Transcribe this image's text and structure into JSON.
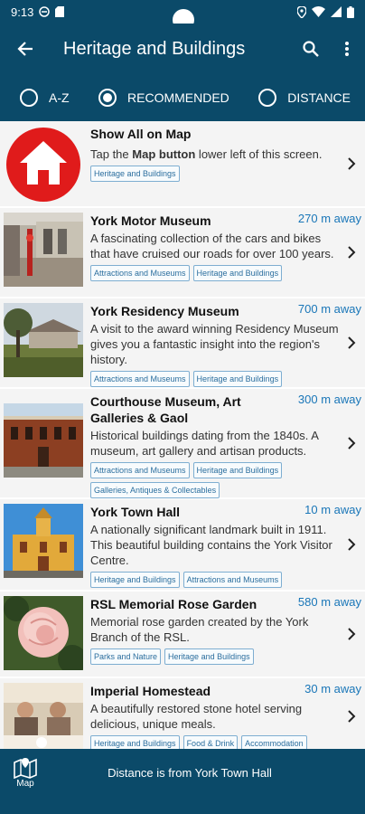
{
  "status": {
    "time": "9:13"
  },
  "appbar": {
    "title": "Heritage and Buildings"
  },
  "filters": {
    "az": "A-Z",
    "recommended": "RECOMMENDED",
    "distance": "DISTANCE"
  },
  "show_all": {
    "title": "Show All on Map",
    "desc_pre": "Tap the ",
    "desc_bold": "Map button",
    "desc_post": " lower left of this screen.",
    "tag": "Heritage and Buildings"
  },
  "items": [
    {
      "name": "York Motor Museum",
      "distance": "270 m away",
      "desc": "A fascinating collection of the cars and bikes that have cruised our roads for over 100 years.",
      "tags": [
        "Attractions and Museums",
        "Heritage and Buildings"
      ]
    },
    {
      "name": "York Residency Museum",
      "distance": "700 m away",
      "desc": "A visit to the award winning Residency Museum gives you a fantastic insight into the region's history.",
      "tags": [
        "Attractions and Museums",
        "Heritage and Buildings"
      ]
    },
    {
      "name": "Courthouse Museum, Art Galleries & Gaol",
      "distance": "300 m away",
      "desc": "Historical buildings dating from the 1840s. A museum, art gallery and artisan products.",
      "tags": [
        "Attractions and Museums",
        "Heritage and Buildings",
        "Galleries, Antiques & Collectables"
      ]
    },
    {
      "name": "York Town Hall",
      "distance": "10 m away",
      "desc": "A nationally significant landmark built in 1911. This beautiful building contains the York Visitor Centre.",
      "tags": [
        "Heritage and Buildings",
        "Attractions and Museums"
      ]
    },
    {
      "name": "RSL Memorial Rose Garden",
      "distance": "580 m away",
      "desc": "Memorial rose garden created by the York Branch of the RSL.",
      "tags": [
        "Parks and Nature",
        "Heritage and Buildings"
      ]
    },
    {
      "name": "Imperial Homestead",
      "distance": "30 m away",
      "desc": "A beautifully restored stone hotel serving delicious, unique meals.",
      "tags": [
        "Heritage and Buildings",
        "Food & Drink",
        "Accommodation"
      ]
    }
  ],
  "bottom": {
    "map_label": "Map",
    "distance_note": "Distance is from York Town Hall"
  },
  "colors": {
    "primary": "#0b4a69",
    "accent": "#1976b8",
    "home_red": "#e01b1b"
  }
}
